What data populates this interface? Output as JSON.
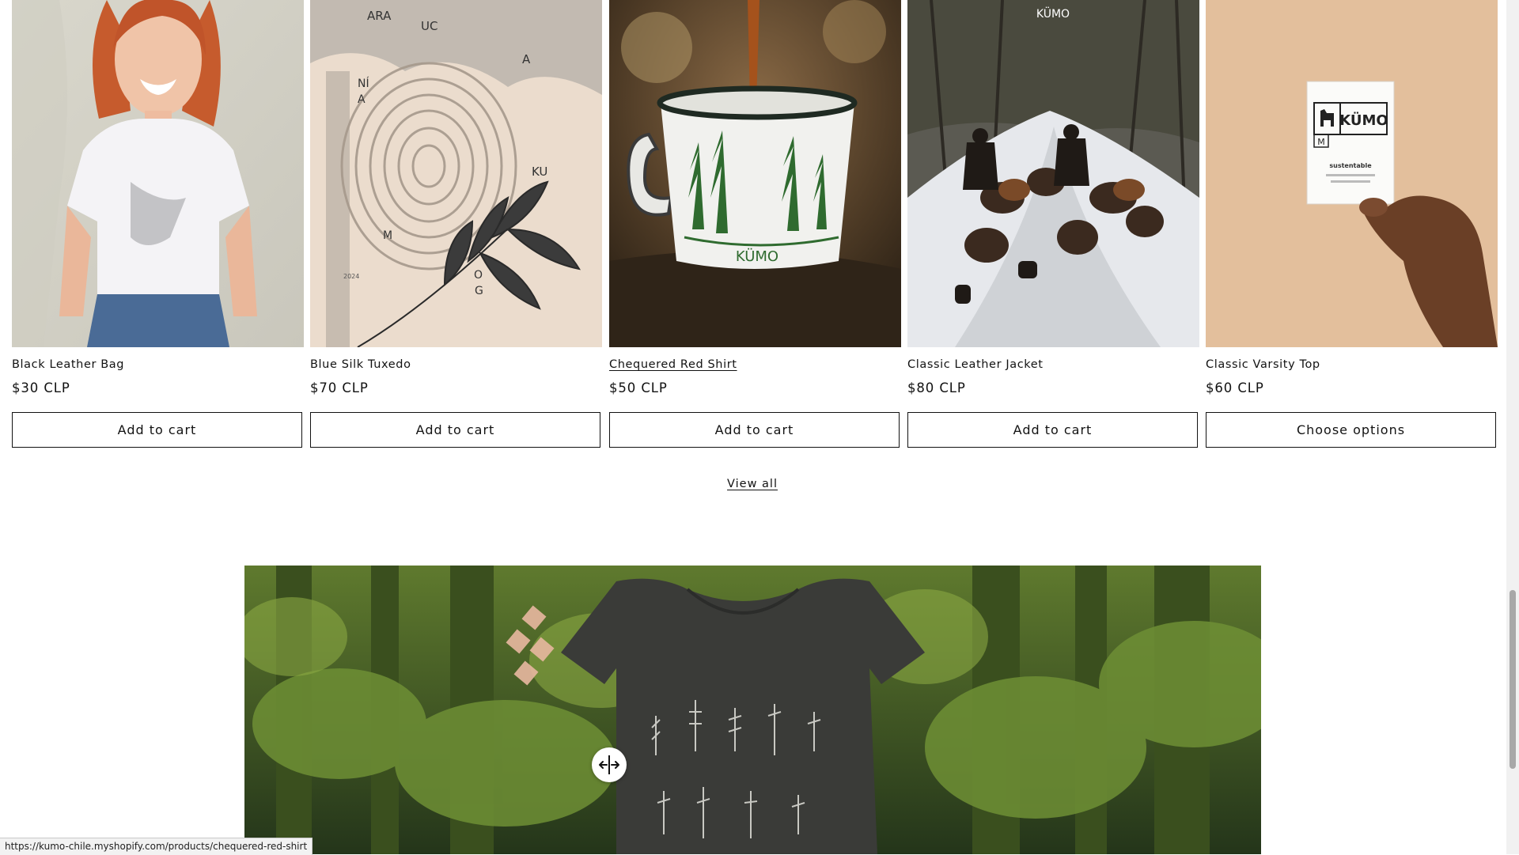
{
  "products": [
    {
      "title": "Black Leather Bag",
      "price": "$30 CLP",
      "button": "Add to cart",
      "image": "woman-white-hummingbird-tee-photo"
    },
    {
      "title": "Blue Silk Tuxedo",
      "price": "$70 CLP",
      "button": "Add to cart",
      "image": "araucania-tree-ring-poster",
      "poster_letters": [
        "ARA",
        "UC",
        "A",
        "NÍ",
        "A",
        "KU",
        "M",
        "O",
        "G"
      ],
      "poster_year": "2024"
    },
    {
      "title": "Chequered Red Shirt",
      "price": "$50 CLP",
      "button": "Add to cart",
      "image": "enamel-forest-mug-photo",
      "mug_brand": "KÜMO"
    },
    {
      "title": "Classic Leather Jacket",
      "price": "$80 CLP",
      "button": "Add to cart",
      "image": "riders-snow-cattle-photo",
      "watermark": "KÜMO"
    },
    {
      "title": "Classic Varsity Top",
      "price": "$60 CLP",
      "button": "Choose options",
      "image": "hand-holding-tag-photo",
      "tag_brand": "KÜMO",
      "tag_size": "M",
      "tag_text": "sustentable"
    }
  ],
  "view_all_label": "View all",
  "banner": {
    "image": "forest-tshirt-comparison-photo",
    "handle_icon": "compare-arrows-icon"
  },
  "status_url": "https://kumo-chile.myshopify.com/products/chequered-red-shirt",
  "colors": {
    "text": "#121212",
    "border": "#121212",
    "background": "#ffffff"
  }
}
